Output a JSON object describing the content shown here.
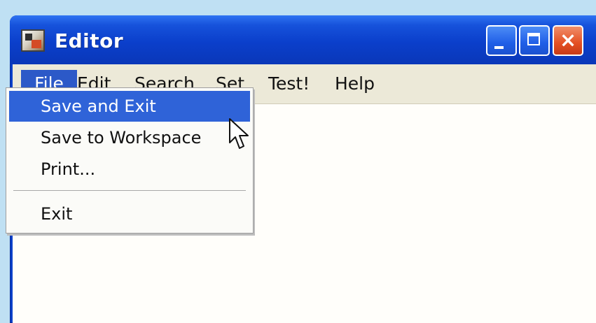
{
  "window": {
    "title": "Editor"
  },
  "menubar": {
    "items": [
      {
        "label": "File"
      },
      {
        "label": "Edit"
      },
      {
        "label": "Search"
      },
      {
        "label": "Set"
      },
      {
        "label": "Test!"
      },
      {
        "label": "Help"
      }
    ]
  },
  "file_menu": {
    "items": [
      {
        "label": "Save and Exit"
      },
      {
        "label": "Save to Workspace"
      },
      {
        "label": "Print..."
      },
      {
        "label": "Exit"
      }
    ]
  },
  "icons": {
    "app": "app-icon",
    "minimize": "minimize-icon",
    "maximize": "maximize-icon",
    "close": "close-icon",
    "cursor": "mouse-cursor-icon"
  },
  "colors": {
    "titlebar": "#0b3fcb",
    "menu_highlight": "#2f63d8",
    "close_button": "#e44f22"
  }
}
